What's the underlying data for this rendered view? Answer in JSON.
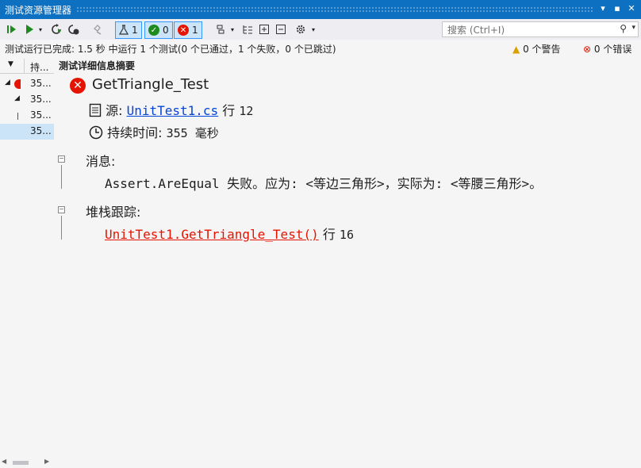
{
  "window": {
    "title": "测试资源管理器",
    "pin": "▾",
    "restore": "▪",
    "close": "✕"
  },
  "toolbar": {
    "run_all_icon": "run-all-icon",
    "flask_count": "1",
    "passed_count": "0",
    "failed_count": "1",
    "search_placeholder": "搜索 (Ctrl+I)"
  },
  "status": {
    "message": "测试运行已完成: 1.5 秒 中运行 1 个测试(0 个已通过，1 个失败，0 个已跳过)",
    "warnings": "0 个警告",
    "errors": "0 个错误"
  },
  "left_panel": {
    "col_header": "持...",
    "rows": [
      "35...",
      "35...",
      "35...",
      "35..."
    ]
  },
  "details": {
    "header": "测试详细信息摘要",
    "test_name": "GetTriangle_Test",
    "source_label": "源:",
    "source_file": "UnitTest1.cs",
    "source_line_label": "行",
    "source_line": "12",
    "duration_label": "持续时间:",
    "duration_value": "355 毫秒",
    "message_label": "消息:",
    "message_text": "Assert.AreEqual 失败。应为: <等边三角形>，实际为: <等腰三角形>。",
    "stack_label": "堆栈跟踪:",
    "stack_link": "UnitTest1.GetTriangle_Test()",
    "stack_line_label": "行",
    "stack_line": "16"
  },
  "colors": {
    "title_bar": "#0e70c0",
    "error": "#e51400",
    "passed": "#1e8b1e",
    "link": "#0645d8"
  }
}
